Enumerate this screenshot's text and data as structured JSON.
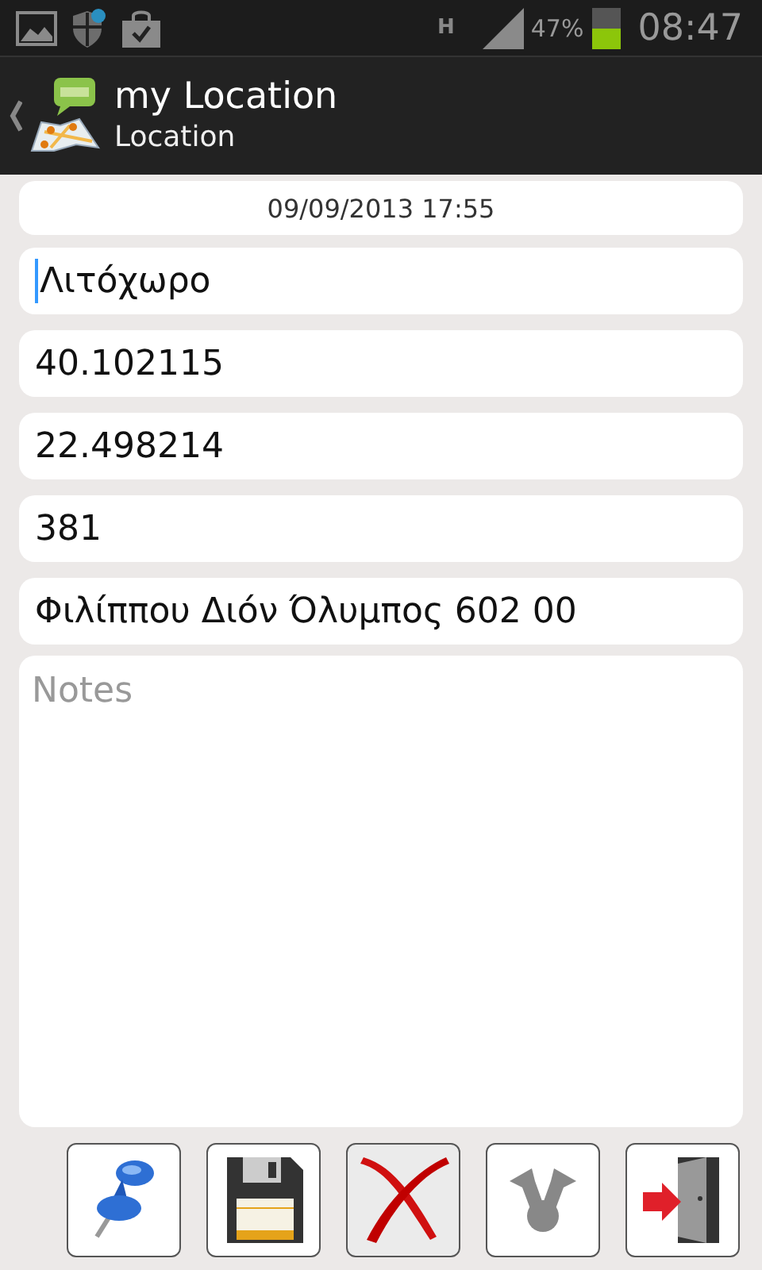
{
  "status_bar": {
    "network": "H",
    "battery": "47%",
    "time": "08:47"
  },
  "action_bar": {
    "title": "my Location",
    "subtitle": "Location"
  },
  "date": "09/09/2013 17:55",
  "fields": [
    {
      "value": "Λιτόχωρο",
      "focused": true
    },
    {
      "value": "40.102115",
      "focused": false
    },
    {
      "value": "22.498214",
      "focused": false
    },
    {
      "value": "381",
      "focused": false
    },
    {
      "value": "Φιλίππου Διόν Όλυμπος 602 00",
      "focused": false
    }
  ],
  "notes": {
    "placeholder": "Notes"
  },
  "buttons": [
    {
      "kind": "pin",
      "pressed": false
    },
    {
      "kind": "save",
      "pressed": false
    },
    {
      "kind": "delete",
      "pressed": true
    },
    {
      "kind": "share",
      "pressed": false
    },
    {
      "kind": "exit",
      "pressed": false
    }
  ]
}
